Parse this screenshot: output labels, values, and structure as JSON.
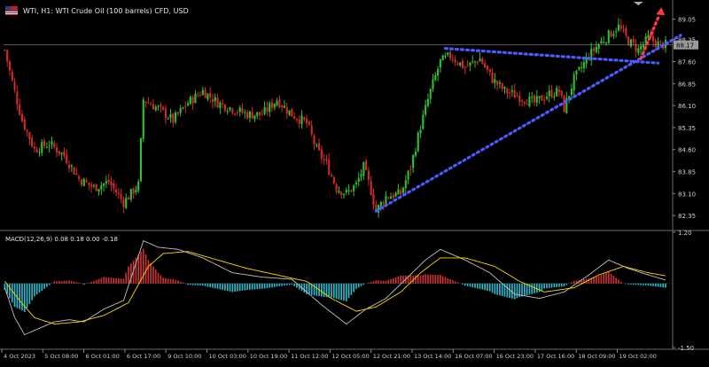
{
  "header": {
    "title": "WTI, H1:  WTI Crude Oil (100 barrels) CFD, USD"
  },
  "macd_label": "MACD(12,26,9) 0.08 0.18 0.00 -0.18",
  "colors": {
    "bull": "#2fbf2f",
    "bear": "#d22a2a",
    "trend": "#4a5cff",
    "arrow": "#ff3b3b",
    "macd_line": "#c0c0c0",
    "signal_line": "#ffd700",
    "hist_pos": "#c83232",
    "hist_neg": "#2fb6c8",
    "grid": "#3a3a3a",
    "axis_text": "#d0d0d0"
  },
  "chart_data": [
    {
      "type": "candlestick",
      "title": "WTI, H1: WTI Crude Oil (100 barrels) CFD, USD",
      "price_axis_labels": [
        "89.05",
        "88.35",
        "87.60",
        "86.85",
        "86.10",
        "85.35",
        "84.60",
        "83.85",
        "83.10",
        "82.35"
      ],
      "current_price_label": "88.17",
      "ylim": [
        81.9,
        89.4
      ],
      "grid": false,
      "annotations": [
        "rising trendline",
        "resistance trendline",
        "upward breakout arrow"
      ],
      "close_path": [
        [
          0,
          88.0
        ],
        [
          3,
          86.9
        ],
        [
          7,
          85.6
        ],
        [
          12,
          84.6
        ],
        [
          18,
          84.8
        ],
        [
          24,
          84.4
        ],
        [
          30,
          83.6
        ],
        [
          36,
          83.3
        ],
        [
          42,
          83.5
        ],
        [
          48,
          82.8
        ],
        [
          54,
          83.4
        ],
        [
          56,
          86.3
        ],
        [
          62,
          86.0
        ],
        [
          68,
          85.6
        ],
        [
          74,
          86.2
        ],
        [
          80,
          86.6
        ],
        [
          86,
          86.2
        ],
        [
          92,
          86.0
        ],
        [
          98,
          85.8
        ],
        [
          104,
          85.8
        ],
        [
          110,
          86.3
        ],
        [
          116,
          85.8
        ],
        [
          122,
          85.5
        ],
        [
          126,
          84.6
        ],
        [
          130,
          84.1
        ],
        [
          134,
          83.3
        ],
        [
          138,
          83.1
        ],
        [
          142,
          83.4
        ],
        [
          145,
          84.0
        ],
        [
          148,
          83.2
        ],
        [
          150,
          82.5
        ],
        [
          154,
          83.0
        ],
        [
          160,
          83.1
        ],
        [
          164,
          84.0
        ],
        [
          168,
          85.4
        ],
        [
          172,
          86.6
        ],
        [
          176,
          87.6
        ],
        [
          180,
          87.8
        ],
        [
          186,
          87.4
        ],
        [
          192,
          87.7
        ],
        [
          197,
          87.0
        ],
        [
          202,
          86.6
        ],
        [
          208,
          86.4
        ],
        [
          214,
          86.2
        ],
        [
          220,
          86.5
        ],
        [
          224,
          86.6
        ],
        [
          226,
          86.0
        ],
        [
          230,
          87.0
        ],
        [
          236,
          87.8
        ],
        [
          240,
          88.2
        ],
        [
          244,
          88.5
        ],
        [
          248,
          88.8
        ],
        [
          252,
          88.3
        ],
        [
          256,
          88.0
        ],
        [
          260,
          88.4
        ],
        [
          264,
          88.2
        ],
        [
          267,
          88.17
        ]
      ]
    },
    {
      "type": "macd",
      "params": "12,26,9",
      "values": {
        "main": 0.08,
        "signal": 0.18,
        "zero": 0.0,
        "diff": -0.18
      },
      "axis_labels": [
        "1.20",
        "-1.50"
      ],
      "ylim": [
        -1.5,
        1.2
      ],
      "macd_line": [
        [
          0,
          -0.1
        ],
        [
          4,
          -0.8
        ],
        [
          8,
          -1.2
        ],
        [
          14,
          -1.05
        ],
        [
          20,
          -0.9
        ],
        [
          26,
          -0.85
        ],
        [
          32,
          -0.9
        ],
        [
          40,
          -0.6
        ],
        [
          48,
          -0.4
        ],
        [
          56,
          1.0
        ],
        [
          62,
          0.85
        ],
        [
          70,
          0.8
        ],
        [
          80,
          0.6
        ],
        [
          92,
          0.25
        ],
        [
          104,
          0.15
        ],
        [
          116,
          0.1
        ],
        [
          128,
          -0.5
        ],
        [
          138,
          -0.95
        ],
        [
          146,
          -0.6
        ],
        [
          154,
          -0.35
        ],
        [
          162,
          0.1
        ],
        [
          170,
          0.55
        ],
        [
          176,
          0.8
        ],
        [
          186,
          0.55
        ],
        [
          196,
          0.25
        ],
        [
          206,
          -0.25
        ],
        [
          216,
          -0.35
        ],
        [
          226,
          -0.2
        ],
        [
          236,
          0.2
        ],
        [
          244,
          0.55
        ],
        [
          252,
          0.35
        ],
        [
          260,
          0.2
        ],
        [
          267,
          0.08
        ]
      ],
      "signal_line": [
        [
          0,
          0.05
        ],
        [
          6,
          -0.4
        ],
        [
          12,
          -0.8
        ],
        [
          20,
          -0.95
        ],
        [
          30,
          -0.9
        ],
        [
          40,
          -0.75
        ],
        [
          50,
          -0.45
        ],
        [
          58,
          0.4
        ],
        [
          64,
          0.7
        ],
        [
          74,
          0.75
        ],
        [
          86,
          0.55
        ],
        [
          98,
          0.35
        ],
        [
          110,
          0.2
        ],
        [
          122,
          0.05
        ],
        [
          132,
          -0.35
        ],
        [
          142,
          -0.65
        ],
        [
          150,
          -0.55
        ],
        [
          160,
          -0.2
        ],
        [
          168,
          0.25
        ],
        [
          176,
          0.6
        ],
        [
          186,
          0.6
        ],
        [
          198,
          0.4
        ],
        [
          208,
          0.05
        ],
        [
          218,
          -0.2
        ],
        [
          230,
          -0.1
        ],
        [
          240,
          0.2
        ],
        [
          250,
          0.4
        ],
        [
          260,
          0.25
        ],
        [
          267,
          0.18
        ]
      ]
    }
  ],
  "time_axis": {
    "labels": [
      "4 Oct 2023",
      "5 Oct 08:00",
      "6 Oct 01:00",
      "6 Oct 17:00",
      "9 Oct 10:00",
      "10 Oct 03:00",
      "10 Oct 19:00",
      "11 Oct 12:00",
      "12 Oct 05:00",
      "12 Oct 21:00",
      "13 Oct 14:00",
      "16 Oct 07:00",
      "16 Oct 23:00",
      "17 Oct 16:00",
      "18 Oct 09:00",
      "19 Oct 02:00"
    ]
  }
}
